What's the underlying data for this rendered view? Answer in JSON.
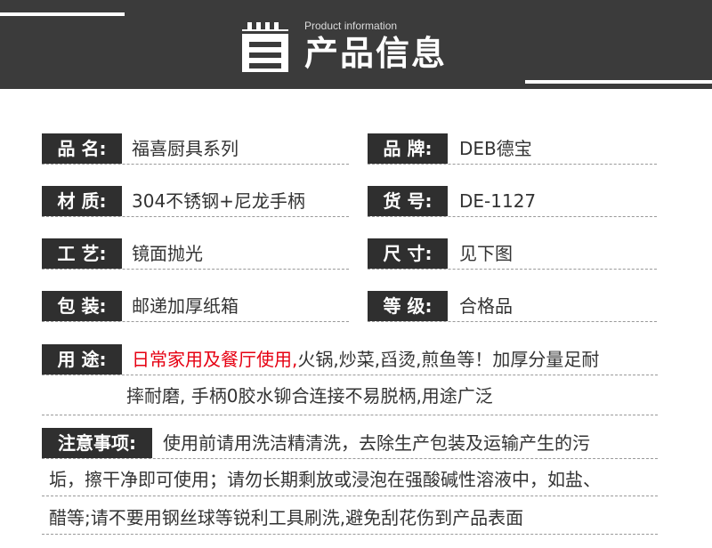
{
  "header": {
    "subtitle_en": "Product information",
    "title_cn": "产品信息",
    "icon": "document-list-icon"
  },
  "fields": {
    "name": {
      "label": "品 名:",
      "value": "福喜厨具系列"
    },
    "brand": {
      "label": "品 牌:",
      "value": "DEB德宝"
    },
    "material": {
      "label": "材 质:",
      "value": "304不锈钢+尼龙手柄"
    },
    "model": {
      "label": "货 号:",
      "value": "DE-1127"
    },
    "craft": {
      "label": "工 艺:",
      "value": "镜面抛光"
    },
    "size": {
      "label": "尺 寸:",
      "value": "见下图"
    },
    "package": {
      "label": "包 装:",
      "value": "邮递加厚纸箱"
    },
    "grade": {
      "label": "等 级:",
      "value": "合格品"
    }
  },
  "usage": {
    "label": "用 途:",
    "highlight": "日常家用及餐厅使用,",
    "line1_rest": "火锅,炒菜,舀烫,煎鱼等！加厚分量足耐",
    "line2": "摔耐磨, 手柄0胶水铆合连接不易脱柄,用途广泛"
  },
  "notes": {
    "label": "注意事项:",
    "line1": "使用前请用洗洁精清洗，去除生产包装及运输产生的污",
    "line2": "垢，擦干净即可使用；请勿长期剩放或浸泡在强酸碱性溶液中，如盐、",
    "line3": "醋等;请不要用钢丝球等锐利工具刷洗,避免刮花伤到产品表面"
  },
  "colors": {
    "header_bg": "#3b3b3b",
    "label_bg": "#2f2f2f",
    "highlight": "#e60012",
    "text": "#333333"
  }
}
